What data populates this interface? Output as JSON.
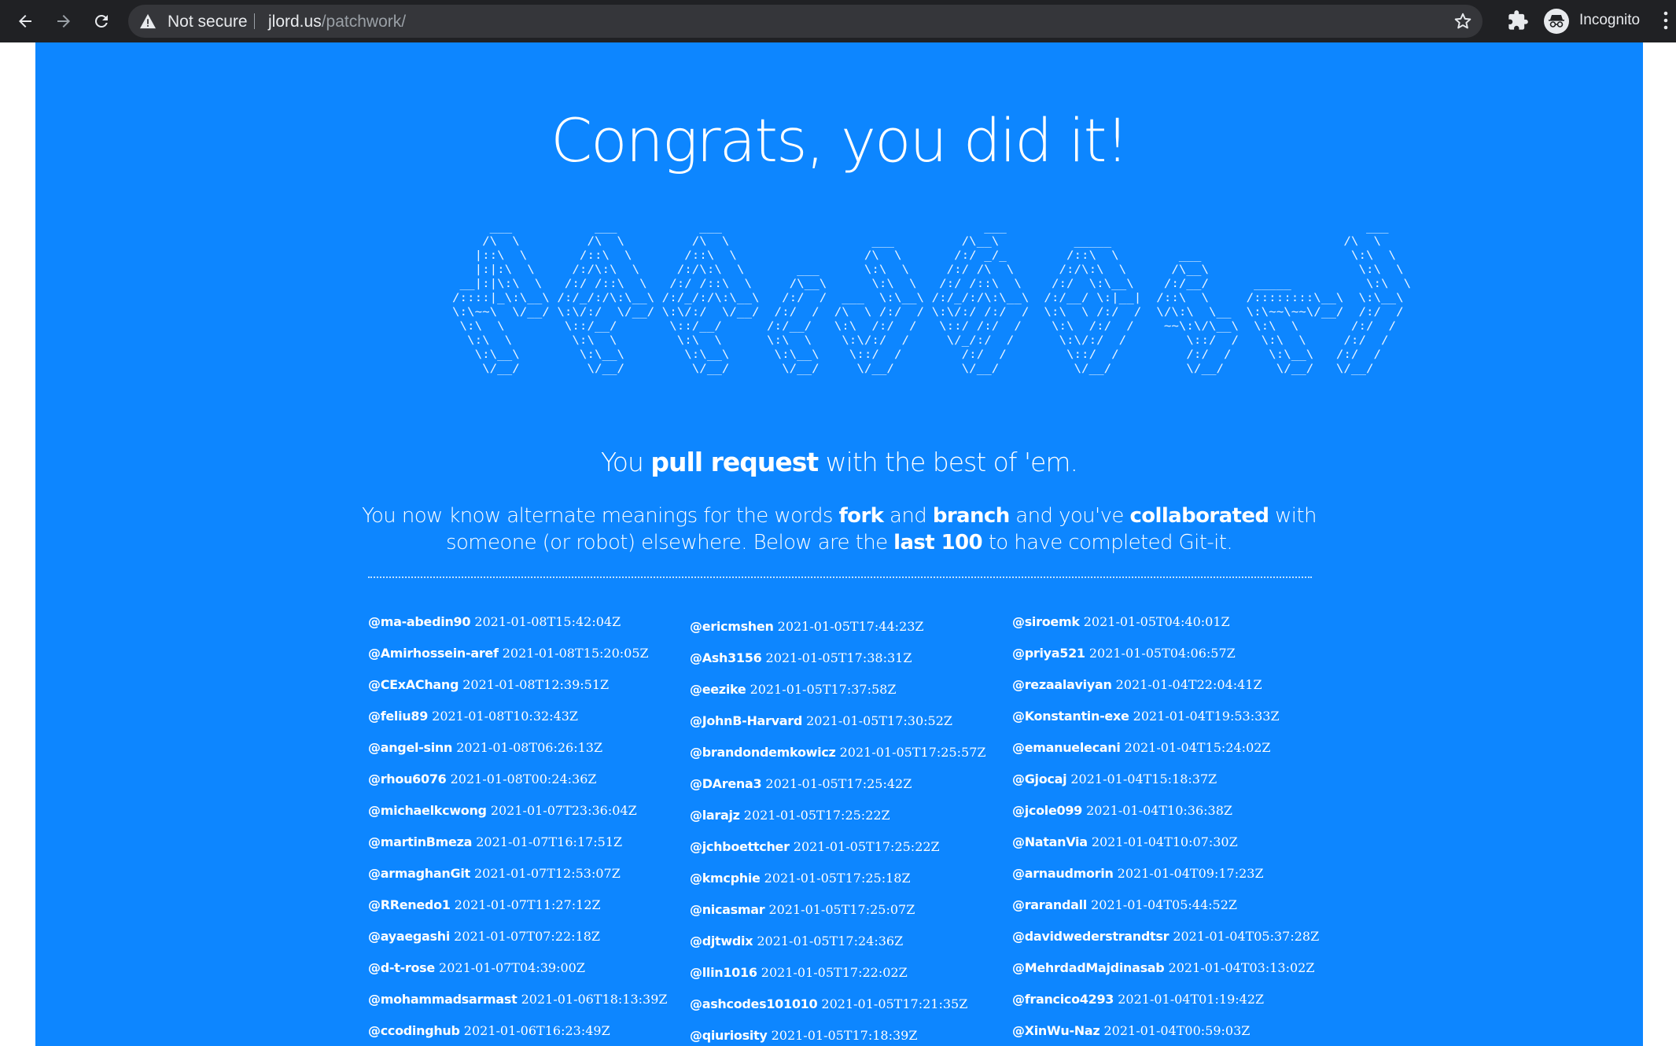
{
  "browser": {
    "security_label": "Not secure",
    "url_host": "jlord.us",
    "url_path": "/patchwork/",
    "profile_label": "Incognito",
    "icons": [
      "back-arrow-icon",
      "forward-arrow-icon",
      "reload-icon",
      "warning-icon",
      "star-icon",
      "puzzle-icon",
      "incognito-icon",
      "more-vert-icon"
    ]
  },
  "page": {
    "title": "Congrats, you did it!",
    "ascii_art": "     ___           ___           ___                                   ___                                                ___     \n    /\\  \\         /\\  \\         /\\  \\                   ___         /\\__\\          _____                               /\\  \\    \n   |::\\  \\       /::\\  \\       /::\\  \\                 /\\  \\       /:/ _/_        /::\\  \\        ___                    \\:\\  \\   \n   |:|:\\  \\     /:/\\:\\  \\     /:/\\:\\  \\       ___      \\:\\  \\     /:/ /\\  \\      /:/\\:\\  \\      /\\__\\                    \\:\\  \\  \n __|:|\\:\\  \\   /:/ /::\\  \\   /:/ /::\\  \\     /\\__\\      \\:\\  \\   /:/ /::\\  \\    /:/  \\:\\__\\    /:/__/      _____          \\:\\  \\ \n/::::|_\\:\\__\\ /:/_/:/\\:\\__\\ /:/_/:/\\:\\__\\   /:/  /  ___  \\:\\__\\ /:/_/:/\\:\\__\\  /:/__/ \\:|__|  /::\\  \\     /::::::::\\__\\  \\:\\__\\\n\\:\\~~\\  \\/__/ \\:\\/:/  \\/__/ \\:\\/:/  \\/__/  /:/  /  /\\  \\ /:/  / \\:\\/:/ /:/  /  \\:\\  \\ /:/  /  \\/\\:\\  \\__  \\:\\~~\\~~\\/__/  /:/  /\n \\:\\  \\        \\::/__/       \\::/__/      /:/__/   \\:\\  /:/  /   \\::/ /:/  /    \\:\\  /:/  /    ~~\\:\\/\\__\\  \\:\\  \\       /:/  / \n  \\:\\  \\        \\:\\  \\        \\:\\  \\      \\:\\  \\    \\:\\/:/  /     \\/_/:/  /      \\:\\/:/  /        \\::/  /   \\:\\  \\     /:/  /  \n   \\:\\__\\        \\:\\__\\        \\:\\__\\      \\:\\__\\    \\::/  /        /:/  /        \\::/  /         /:/  /     \\:\\__\\   /:/  /   \n    \\/__/         \\/__/         \\/__/       \\/__/     \\/__/         \\/__/          \\/__/          \\/__/       \\/__/   \\/__/    ",
    "tagline_prefix": "You ",
    "tagline_bold": "pull request",
    "tagline_suffix": " with the best of 'em.",
    "desc_part1": "You now know alternate meanings for the words ",
    "desc_fork": "fork",
    "desc_part2": " and ",
    "desc_branch": "branch",
    "desc_part3": " and you've ",
    "desc_collaborated": "collaborated",
    "desc_part4": " with someone (or robot) elsewhere. Below are the ",
    "desc_last100": "last 100",
    "desc_part5": " to have completed Git-it."
  },
  "completions": {
    "column1": [
      {
        "user": "@ma-abedin90",
        "time": "2021-01-08T15:42:04Z"
      },
      {
        "user": "@Amirhossein-aref",
        "time": "2021-01-08T15:20:05Z"
      },
      {
        "user": "@CExAChang",
        "time": "2021-01-08T12:39:51Z"
      },
      {
        "user": "@feliu89",
        "time": "2021-01-08T10:32:43Z"
      },
      {
        "user": "@angel-sinn",
        "time": "2021-01-08T06:26:13Z"
      },
      {
        "user": "@rhou6076",
        "time": "2021-01-08T00:24:36Z"
      },
      {
        "user": "@michaelkcwong",
        "time": "2021-01-07T23:36:04Z"
      },
      {
        "user": "@martinBmeza",
        "time": "2021-01-07T16:17:51Z"
      },
      {
        "user": "@armaghanGit",
        "time": "2021-01-07T12:53:07Z"
      },
      {
        "user": "@RRenedo1",
        "time": "2021-01-07T11:27:12Z"
      },
      {
        "user": "@ayaegashi",
        "time": "2021-01-07T07:22:18Z"
      },
      {
        "user": "@d-t-rose",
        "time": "2021-01-07T04:39:00Z"
      },
      {
        "user": "@mohammadsarmast",
        "time": "2021-01-06T18:13:39Z"
      },
      {
        "user": "@ccodinghub",
        "time": "2021-01-06T16:23:49Z"
      }
    ],
    "column2": [
      {
        "user": "@ericmshen",
        "time": "2021-01-05T17:44:23Z"
      },
      {
        "user": "@Ash3156",
        "time": "2021-01-05T17:38:31Z"
      },
      {
        "user": "@eezike",
        "time": "2021-01-05T17:37:58Z"
      },
      {
        "user": "@JohnB-Harvard",
        "time": "2021-01-05T17:30:52Z"
      },
      {
        "user": "@brandondemkowicz",
        "time": "2021-01-05T17:25:57Z"
      },
      {
        "user": "@DArena3",
        "time": "2021-01-05T17:25:42Z"
      },
      {
        "user": "@larajz",
        "time": "2021-01-05T17:25:22Z"
      },
      {
        "user": "@jchboettcher",
        "time": "2021-01-05T17:25:22Z"
      },
      {
        "user": "@kmcphie",
        "time": "2021-01-05T17:25:18Z"
      },
      {
        "user": "@nicasmar",
        "time": "2021-01-05T17:25:07Z"
      },
      {
        "user": "@djtwdix",
        "time": "2021-01-05T17:24:36Z"
      },
      {
        "user": "@llin1016",
        "time": "2021-01-05T17:22:02Z"
      },
      {
        "user": "@ashcodes101010",
        "time": "2021-01-05T17:21:35Z"
      },
      {
        "user": "@qiuriosity",
        "time": "2021-01-05T17:18:39Z"
      }
    ],
    "column3": [
      {
        "user": "@siroemk",
        "time": "2021-01-05T04:40:01Z"
      },
      {
        "user": "@priya521",
        "time": "2021-01-05T04:06:57Z"
      },
      {
        "user": "@rezaalaviyan",
        "time": "2021-01-04T22:04:41Z"
      },
      {
        "user": "@Konstantin-exe",
        "time": "2021-01-04T19:53:33Z"
      },
      {
        "user": "@emanuelecani",
        "time": "2021-01-04T15:24:02Z"
      },
      {
        "user": "@Gjocaj",
        "time": "2021-01-04T15:18:37Z"
      },
      {
        "user": "@jcole099",
        "time": "2021-01-04T10:36:38Z"
      },
      {
        "user": "@NatanVia",
        "time": "2021-01-04T10:07:30Z"
      },
      {
        "user": "@arnaudmorin",
        "time": "2021-01-04T09:17:23Z"
      },
      {
        "user": "@rarandall",
        "time": "2021-01-04T05:44:52Z"
      },
      {
        "user": "@davidwederstrandtsr",
        "time": "2021-01-04T05:37:28Z"
      },
      {
        "user": "@MehrdadMajdinasab",
        "time": "2021-01-04T03:13:02Z"
      },
      {
        "user": "@francico4293",
        "time": "2021-01-04T01:19:42Z"
      },
      {
        "user": "@XinWu-Naz",
        "time": "2021-01-04T00:59:03Z"
      }
    ]
  },
  "colors": {
    "page_background": "#0d86ff",
    "chrome_background": "#202124",
    "omnibox_background": "#35363a",
    "text": "#ffffff"
  }
}
